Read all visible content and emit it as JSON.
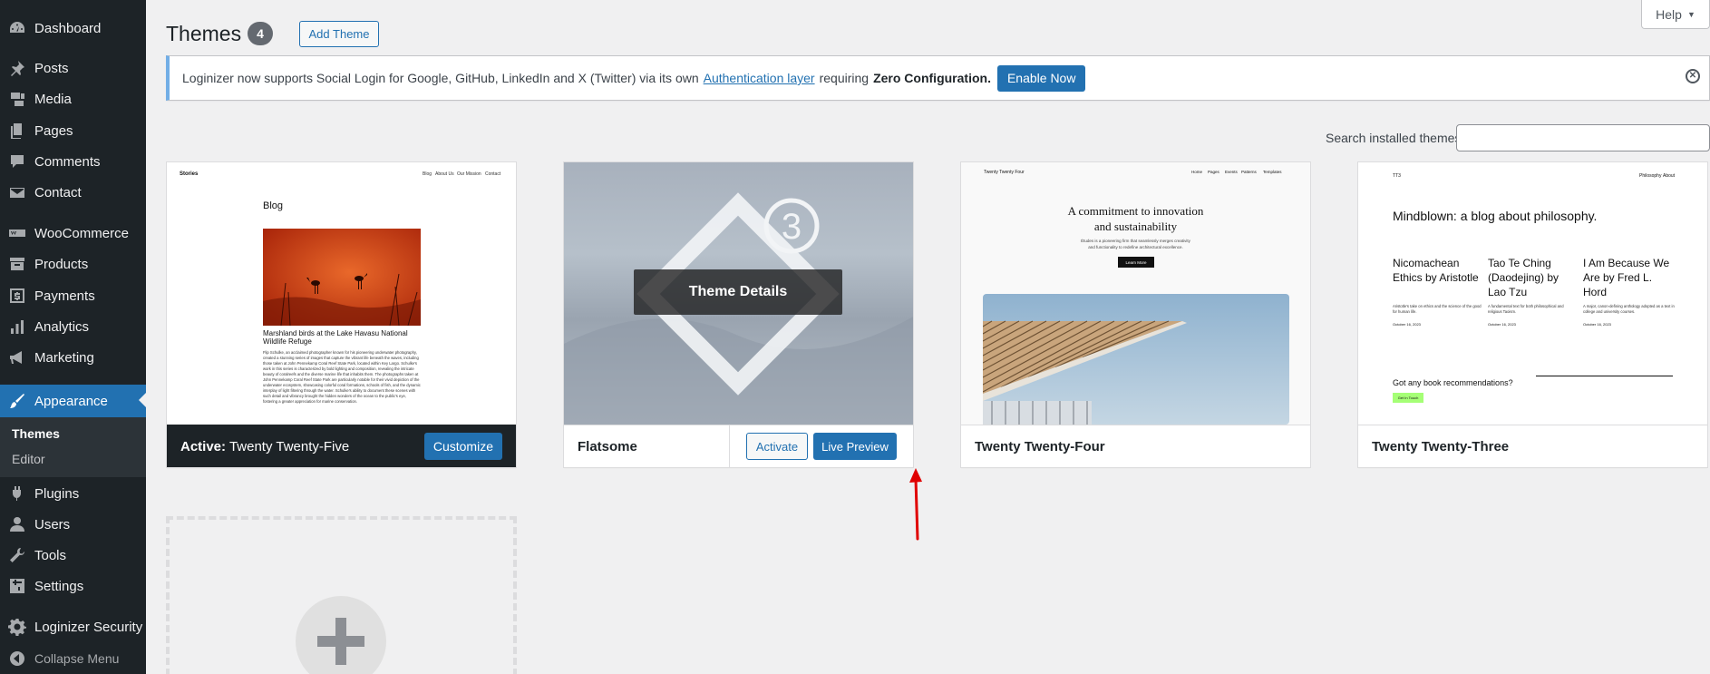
{
  "sidebar": {
    "items": [
      {
        "label": "Dashboard",
        "icon": "dashboard-icon"
      },
      {
        "label": "Posts",
        "icon": "pin-icon"
      },
      {
        "label": "Media",
        "icon": "media-icon"
      },
      {
        "label": "Pages",
        "icon": "pages-icon"
      },
      {
        "label": "Comments",
        "icon": "comment-icon"
      },
      {
        "label": "Contact",
        "icon": "envelope-icon"
      },
      {
        "label": "WooCommerce",
        "icon": "woocommerce-icon"
      },
      {
        "label": "Products",
        "icon": "archive-icon"
      },
      {
        "label": "Payments",
        "icon": "dollar-icon"
      },
      {
        "label": "Analytics",
        "icon": "bar-chart-icon"
      },
      {
        "label": "Marketing",
        "icon": "megaphone-icon"
      },
      {
        "label": "Appearance",
        "icon": "paintbrush-icon"
      },
      {
        "label": "Plugins",
        "icon": "plug-icon"
      },
      {
        "label": "Users",
        "icon": "user-icon"
      },
      {
        "label": "Tools",
        "icon": "wrench-icon"
      },
      {
        "label": "Settings",
        "icon": "settings-icon"
      },
      {
        "label": "Loginizer Security",
        "icon": "gear-icon"
      }
    ],
    "submenu": {
      "themes": "Themes",
      "editor": "Editor"
    },
    "collapse_label": "Collapse Menu"
  },
  "header": {
    "title": "Themes",
    "count": "4",
    "add_theme_label": "Add Theme",
    "help_label": "Help"
  },
  "notice": {
    "text_before": "Loginizer now supports Social Login for Google, GitHub, LinkedIn and X (Twitter) via its own",
    "link_text": "Authentication layer",
    "text_mid": "requiring",
    "bold_text": "Zero Configuration.",
    "button_label": "Enable Now"
  },
  "search": {
    "label": "Search installed themes",
    "value": ""
  },
  "themes": [
    {
      "name": "Twenty Twenty-Five",
      "active_prefix": "Active:",
      "action": "Customize",
      "preview": {
        "site": "Stories",
        "nav": [
          "Blog",
          "About Us",
          "Our Mission",
          "Contact"
        ],
        "heading": "Blog",
        "post_title": "Marshland birds at the Lake Havasu National Wildlife Refuge",
        "post_text": "Flip Schulke, an acclaimed photographer known for his pioneering underwater photography, created a stunning series of images that capture the vibrant life beneath the waves, including those taken at John Pennekamp Coral Reef State Park, located within Key Largo. Schulke's work in this series is characterized by bold lighting and composition, revealing the intricate beauty of coralreefs and the diverse marine life that inhabits them. The photographs taken at John Pennekamp Coral Reef State Park are particularly notable for their vivid depiction of the underwater ecosystem, showcasing colorful coral formations, schools of fish, and the dynamic interplay of light filtering through the water. Schulke's ability to document these scenes with such detail and vibrancy brought the hidden wonders of the ocean to the public's eye, fostering a greater appreciation for marine conservation."
      }
    },
    {
      "name": "Flatsome",
      "overlay_label": "Theme Details",
      "logo_number": "3",
      "activate_label": "Activate",
      "live_preview_label": "Live Preview"
    },
    {
      "name": "Twenty Twenty-Four",
      "preview": {
        "site": "Twenty Twenty Four",
        "nav": [
          "Home",
          "Pages",
          "Events",
          "Patterns",
          "Templates"
        ],
        "headline_1": "A commitment to innovation",
        "headline_2": "and sustainability",
        "sub_1": "Études is a pioneering firm that seamlessly merges creativity",
        "sub_2": "and functionality to redefine architectural excellence.",
        "button": "Learn More"
      }
    },
    {
      "name": "Twenty Twenty-Three",
      "preview": {
        "site": "TT3",
        "nav": [
          "Philosophy",
          "About"
        ],
        "headline": "Mindblown: a blog about philosophy.",
        "posts": [
          {
            "title": "Nicomachean Ethics by Aristotle",
            "excerpt": "Aristotle's take on ethics and the science of the good for human life.",
            "date": "October 16, 2023"
          },
          {
            "title": "Tao Te Ching (Daodejing) by Lao Tzu",
            "excerpt": "A fundamental text for both philosophical and religious Taoism.",
            "date": "October 16, 2023"
          },
          {
            "title": "I Am Because We Are by Fred L. Hord",
            "excerpt": "A major, canon-defining anthology adopted as a text in college and university courses.",
            "date": "October 16, 2023"
          }
        ],
        "cta": "Got any book recommendations?",
        "cta_button": "Get In Touch"
      }
    }
  ],
  "colors": {
    "accent": "#2271b1",
    "sidebar": "#1d2327",
    "annotation": "#e00000"
  }
}
